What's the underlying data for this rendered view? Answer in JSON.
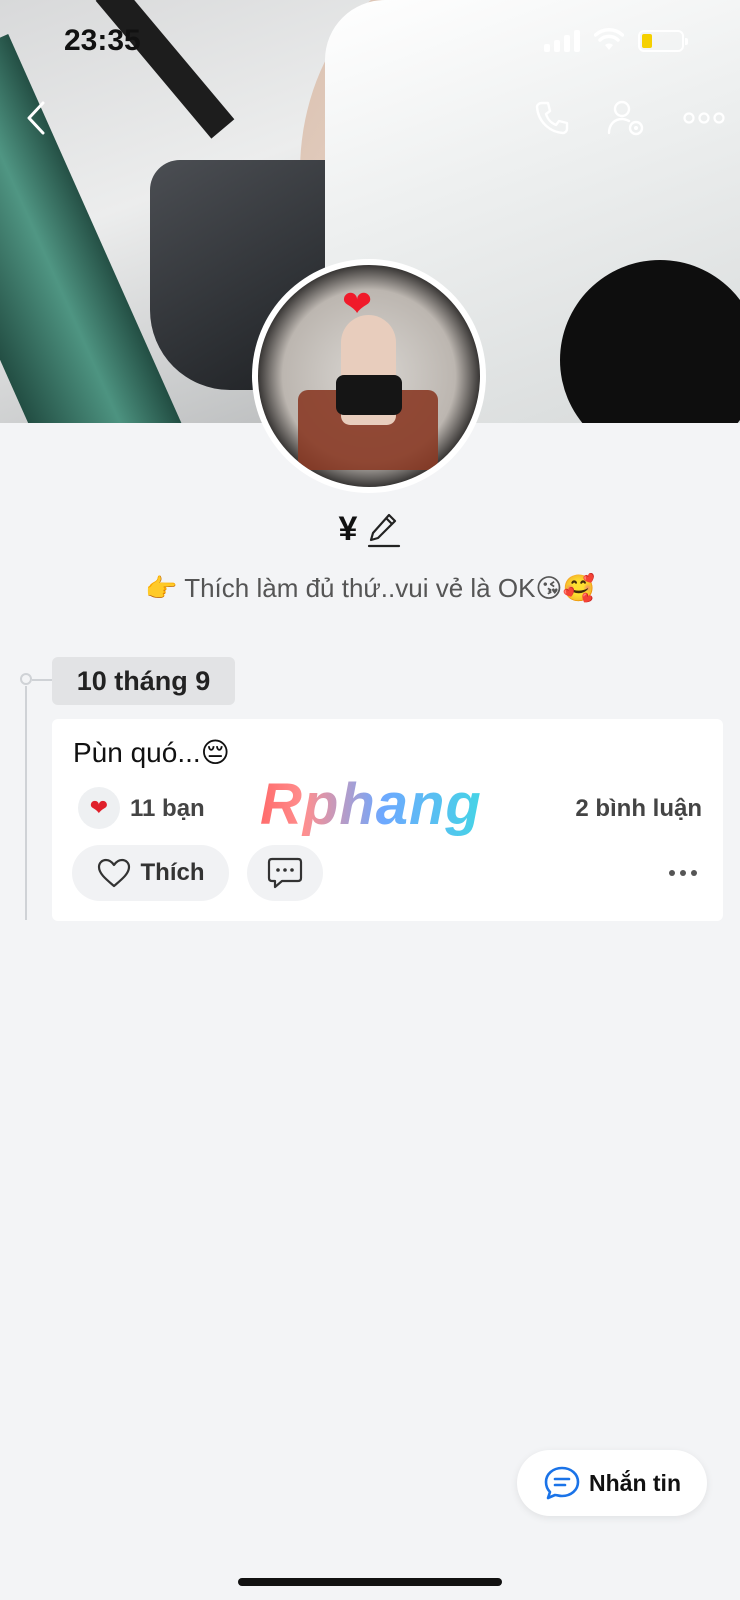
{
  "status_bar": {
    "time": "23:35",
    "icons": [
      "signal-icon",
      "wifi-icon",
      "battery-icon"
    ],
    "battery_color": "#f5d000"
  },
  "nav": {
    "icons": [
      "back-chevron-icon",
      "phone-icon",
      "user-settings-icon",
      "more-horizontal-icon"
    ]
  },
  "profile": {
    "name": "¥",
    "bio": "👉 Thích làm đủ thứ..vui vẻ là OK😘🥰"
  },
  "timeline": {
    "date_label": "10 tháng 9",
    "post": {
      "text": "Pùn quó...😔",
      "reaction_icon": "❤",
      "reaction_count": "11 bạn",
      "watermark": "Rphang",
      "comments": "2 bình luận",
      "like_label": "Thích"
    }
  },
  "message_button": {
    "label": "Nhắn tin",
    "accent": "#1a73e8"
  }
}
